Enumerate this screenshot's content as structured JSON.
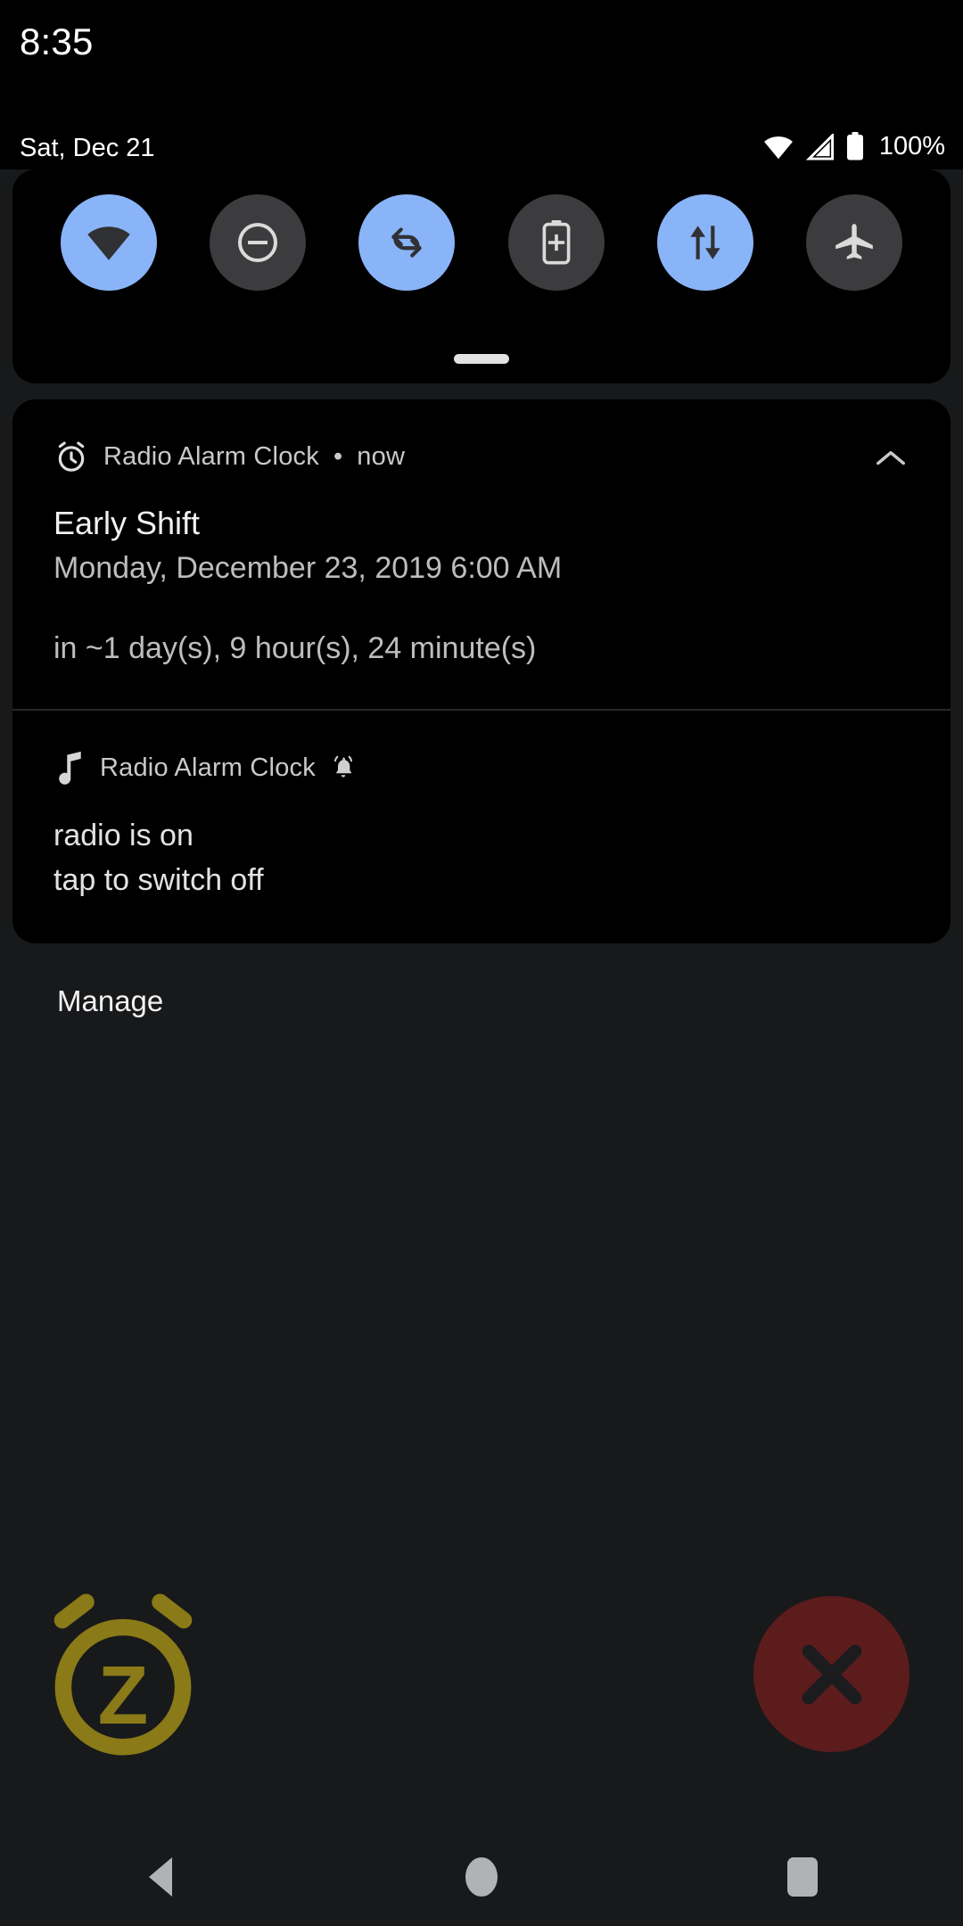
{
  "status": {
    "clock": "8:35",
    "date": "Sat, Dec 21",
    "battery_percent": "100%",
    "icons": [
      "wifi-icon",
      "cellular-signal-icon",
      "battery-icon"
    ]
  },
  "quick_settings": {
    "tiles": [
      {
        "name": "wifi",
        "label": "Wi-Fi",
        "state": "on"
      },
      {
        "name": "do-not-disturb",
        "label": "Do Not Disturb",
        "state": "off"
      },
      {
        "name": "auto-rotate",
        "label": "Auto-rotate",
        "state": "on"
      },
      {
        "name": "battery-saver",
        "label": "Battery Saver",
        "state": "off"
      },
      {
        "name": "mobile-data",
        "label": "Mobile data",
        "state": "on"
      },
      {
        "name": "airplane-mode",
        "label": "Airplane mode",
        "state": "off"
      }
    ],
    "handle": "drag-handle"
  },
  "notifications": [
    {
      "app_name": "Radio Alarm Clock",
      "separator": "•",
      "time": "now",
      "icon": "alarm-clock-icon",
      "expand_icon": "chevron-up-icon",
      "title": "Early Shift",
      "subtitle": "Monday, December 23, 2019 6:00 AM",
      "extra": "in ~1 day(s), 9 hour(s), 24 minute(s)"
    },
    {
      "app_name": "Radio Alarm Clock",
      "icon": "music-note-icon",
      "badge_icon": "bell-ringing-icon",
      "line1": "radio is on",
      "line2": "tap to switch off"
    }
  ],
  "manage": {
    "label": "Manage"
  },
  "alarm_actions": {
    "snooze": {
      "name": "snooze-alarm-icon",
      "letter": "Z",
      "color": "#8a7a18"
    },
    "dismiss": {
      "name": "dismiss-alarm-icon",
      "color": "#5d1c1c",
      "glyph_color": "#1c1c1e"
    }
  },
  "navbar": {
    "back": "back-button",
    "home": "home-button",
    "recents": "recents-button"
  },
  "colors": {
    "background": "#18191b",
    "panel": "#000000",
    "tile_on": "#8ab4f8",
    "tile_off": "#3c3c3e",
    "text_primary": "#ffffff",
    "text_secondary": "#bdbdbd"
  }
}
